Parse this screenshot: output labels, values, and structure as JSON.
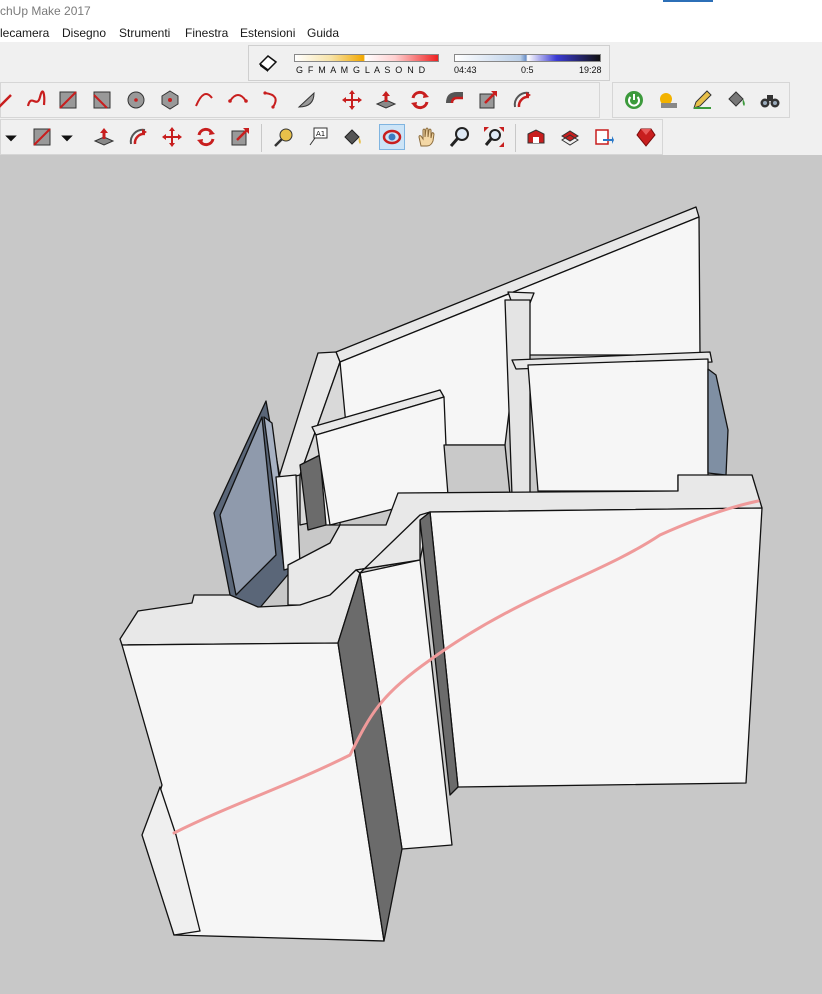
{
  "window": {
    "title": "chUp Make 2017"
  },
  "menu": [
    {
      "label": "lecamera"
    },
    {
      "label": "Disegno"
    },
    {
      "label": "Strumenti"
    },
    {
      "label": "Finestra"
    },
    {
      "label": "Estensioni"
    },
    {
      "label": "Guida"
    }
  ],
  "shadow_panel": {
    "months": "G F M A M G L A S O N D",
    "time_start": "04:43",
    "time_mid": "0:5",
    "time_end": "19:28"
  },
  "colors": {
    "viewport_bg": "#c8c8c8",
    "face_light": "#f6f6f6",
    "face_top": "#e8e8e8",
    "face_dark": "#6b6b6b",
    "glass": "#8f9aac",
    "section_line": "#ef9a9a",
    "tool_red": "#c81e1e",
    "tool_active_bg": "#cce4f7"
  },
  "toolbars": {
    "row1": [
      "freehand-line-icon",
      "freehand-curve-icon",
      "rectangle-icon",
      "rotated-rectangle-icon",
      "circle-icon",
      "polygon-icon",
      "arc-icon",
      "two-point-arc-icon",
      "three-point-arc-icon",
      "pie-icon",
      "move-icon",
      "push-pull-icon",
      "rotate-icon",
      "follow-me-icon",
      "scale-icon",
      "offset-icon"
    ],
    "row1_right": [
      "power-icon",
      "shadow-sun-icon",
      "pencil-style-icon",
      "paint-bucket-icon",
      "binoculars-icon"
    ],
    "row2": [
      "dropdown-icon",
      "rectangle-icon",
      "dropdown-icon",
      "push-pull-icon",
      "follow-me-icon",
      "move-icon",
      "rotate-icon",
      "scale-icon",
      "tape-measure-icon",
      "text-label-icon",
      "paint-bucket-icon",
      "orbit-icon",
      "pan-icon",
      "zoom-icon",
      "zoom-extents-icon",
      "warehouse-icon",
      "share-model-icon",
      "extension-warehouse-icon",
      "ruby-icon"
    ]
  }
}
